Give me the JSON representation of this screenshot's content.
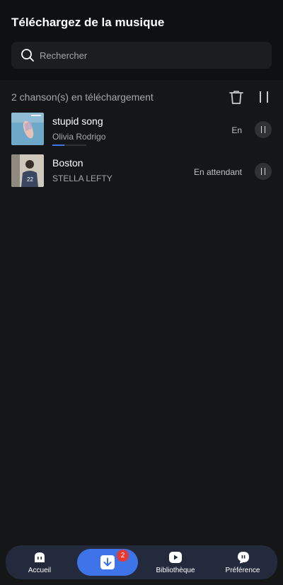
{
  "header": {
    "title": "Téléchargez de la musique",
    "search_placeholder": "Rechercher",
    "search_value": ""
  },
  "downloads": {
    "count_text": "2 chanson(s) en téléchargement",
    "items": [
      {
        "title": "stupid song",
        "artist": "Olivia Rodrigo",
        "status": "En",
        "progress": 0.35,
        "cover_colors": [
          "#6fa9c9",
          "#d7e3e8"
        ]
      },
      {
        "title": "Boston",
        "artist": "STELLA LEFTY",
        "status": "En attendant",
        "cover_colors": [
          "#cfc9bd",
          "#3b4660"
        ]
      }
    ]
  },
  "nav": {
    "items": [
      {
        "label": "Accueil",
        "icon": "home-icon"
      },
      {
        "label": "",
        "icon": "download-icon",
        "badge": "2",
        "active": true
      },
      {
        "label": "Bibliothèque",
        "icon": "library-icon"
      },
      {
        "label": "Préférence",
        "icon": "preference-icon"
      }
    ]
  },
  "colors": {
    "accent": "#3f73e8",
    "badge": "#e53935",
    "background": "#151617",
    "navbar": "#232a3b"
  }
}
